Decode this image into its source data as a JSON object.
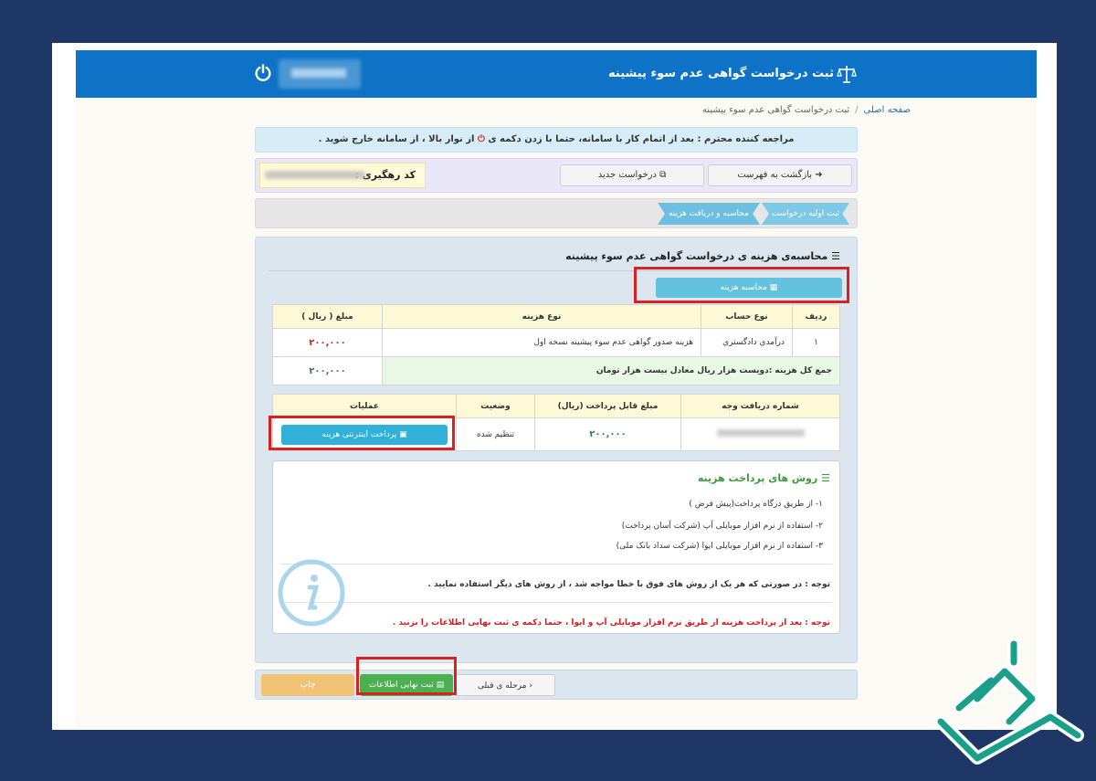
{
  "header": {
    "title": "ثبت درخواست گواهی عدم سوء پیشینه",
    "brand_color": "#0e73c6"
  },
  "breadcrumb": {
    "home": "صفحه اصلی",
    "current": "ثبت درخواست گواهی عدم سوء پیشینه"
  },
  "notice": {
    "before": "مراجعه کننده محترم : بعد از اتمام کار با سامانه، حتما با زدن دکمه ی",
    "after": "از نوار بالا ، از سامانه خارج شوید ."
  },
  "toolbar": {
    "back_label": "بازگشت به فهرست",
    "new_label": "درخواست جدید",
    "tracking_code_label": "کد رهگیری :"
  },
  "steps": [
    {
      "label": "ثبت اولیه درخواست"
    },
    {
      "label": "محاسبه و دریافت هزینه"
    }
  ],
  "calc": {
    "section_title": "محاسبه‌ی هزینه ی درخواست گواهی عدم سوء پیشینه",
    "button_label": "محاسبه هزینه"
  },
  "cost_table": {
    "headers": [
      "ردیف",
      "نوع حساب",
      "نوع هزینه",
      "مبلغ ( ریال )"
    ],
    "rows": [
      {
        "index": "۱",
        "account": "درآمدي دادگستري",
        "type": "هزینه صدور گواهی عدم سوء پیشینه نسخه اول",
        "amount": "۲۰۰,۰۰۰"
      }
    ],
    "total_label": "جمع کل هزینه :دویست هزار ریال معادل بیست هزار تومان",
    "total_amount": "۲۰۰,۰۰۰"
  },
  "payment_table": {
    "headers": [
      "شماره دریافت وجه",
      "مبلغ قابل پرداخت (ریال)",
      "وضعیت",
      "عملیات"
    ],
    "amount": "۲۰۰,۰۰۰",
    "status": "تنظیم شده",
    "pay_button": "پرداخت اینترنتی هزینه"
  },
  "methods": {
    "title": "روش های پرداخت هزینه",
    "items": [
      "۱- از طریق درگاه پرداخت(پیش فرض )",
      "۲- استفاده از نرم افزار موبایلی آپ (شرکت آسان پرداخت)",
      "۳- استفاده از نرم افزار موبایلی ایوا (شرکت سداد بانک ملی)"
    ],
    "note": "توجه : در صورتی که هر یک از روش های فوق با خطا مواجه شد ، از روش های دیگر استفاده نمایید .",
    "warning": "توجه : بعد از پرداخت هزینه از طریق نرم افزار موبایلی آپ و ایوا ، حتما دکمه ی ثبت نهایی اطلاعات را بزنید ."
  },
  "footer": {
    "prev_label": "مرحله ی قبلی",
    "final_label": "ثبت نهایی اطلاعات",
    "print_label": "چاپ"
  },
  "colors": {
    "highlight": "#d62222",
    "final_green": "#4caf50",
    "print_orange": "#f0c274",
    "calc_cyan": "#63c2dd"
  }
}
